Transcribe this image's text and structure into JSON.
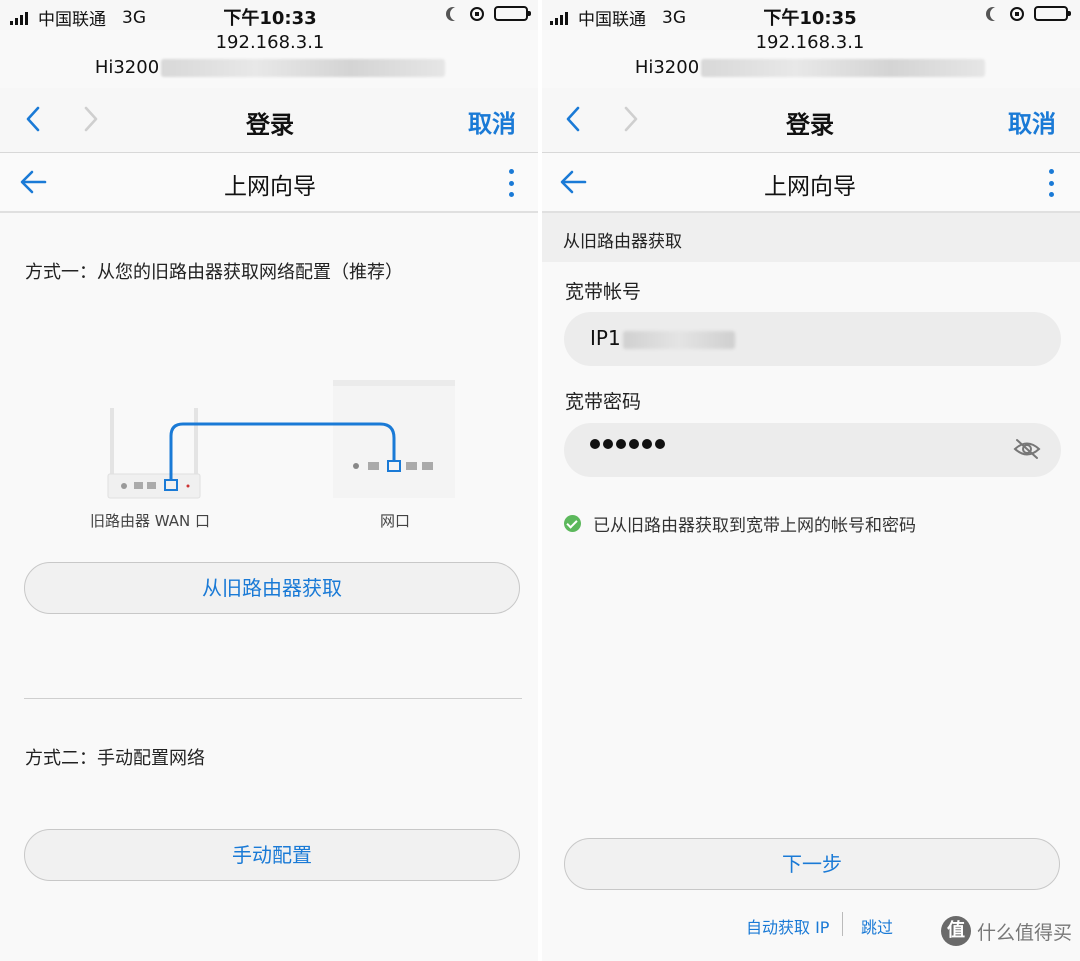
{
  "left": {
    "status": {
      "carrier": "中国联通",
      "network": "3G",
      "time": "下午10:33"
    },
    "browser": {
      "address": "192.168.3.1",
      "ssid_prefix": "Hi3200",
      "title": "登录",
      "cancel": "取消"
    },
    "app": {
      "title": "上网向导"
    },
    "method1": {
      "label": "方式一：从您的旧路由器获取网络配置（推荐）",
      "button": "从旧路由器获取"
    },
    "illustration": {
      "old_router_label": "旧路由器 WAN 口",
      "new_router_label": "网口"
    },
    "method2": {
      "label": "方式二：手动配置网络",
      "button": "手动配置"
    }
  },
  "right": {
    "status": {
      "carrier": "中国联通",
      "network": "3G",
      "time": "下午10:35"
    },
    "browser": {
      "address": "192.168.3.1",
      "ssid_prefix": "Hi3200",
      "title": "登录",
      "cancel": "取消"
    },
    "app": {
      "title": "上网向导"
    },
    "section": "从旧路由器获取",
    "account": {
      "label": "宽带帐号",
      "value_prefix": "IP1"
    },
    "password": {
      "label": "宽带密码",
      "masked_length": 6
    },
    "success_message": "已从旧路由器获取到宽带上网的帐号和密码",
    "next_button": "下一步",
    "links": {
      "auto_ip": "自动获取 IP",
      "skip": "跳过"
    }
  },
  "watermark": {
    "badge": "值",
    "text": "什么值得买"
  },
  "colors": {
    "accent": "#1a7ad6",
    "success": "#5cb85c",
    "background": "#f9f9f9"
  }
}
